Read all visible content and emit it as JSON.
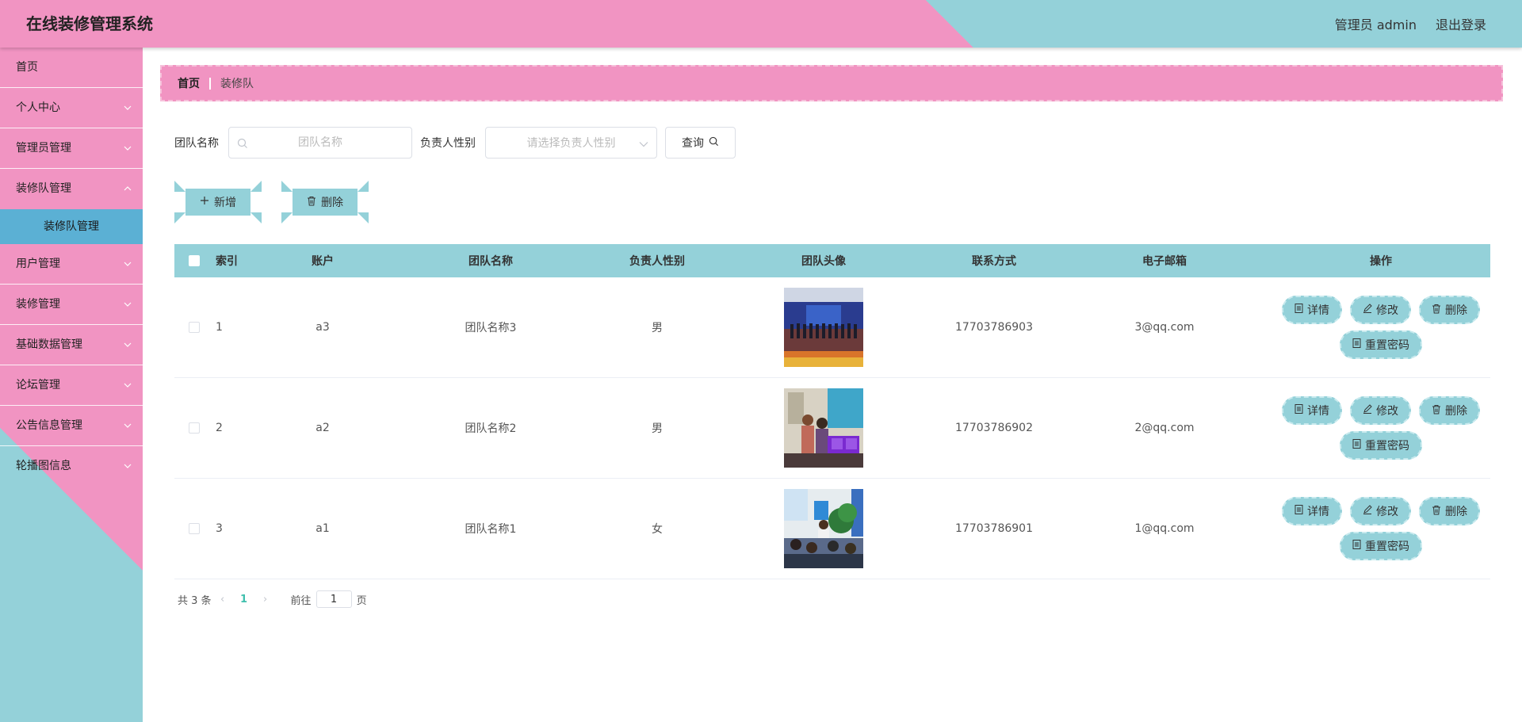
{
  "header": {
    "title": "在线装修管理系统",
    "user": "管理员 admin",
    "logout": "退出登录"
  },
  "sidebar": {
    "items": [
      {
        "label": "首页"
      },
      {
        "label": "个人中心"
      },
      {
        "label": "管理员管理"
      },
      {
        "label": "装修队管理",
        "submenu": "装修队管理"
      },
      {
        "label": "用户管理"
      },
      {
        "label": "装修管理"
      },
      {
        "label": "基础数据管理"
      },
      {
        "label": "论坛管理"
      },
      {
        "label": "公告信息管理"
      },
      {
        "label": "轮播图信息"
      }
    ]
  },
  "breadcrumb": {
    "home": "首页",
    "current": "装修队"
  },
  "search": {
    "team_label": "团队名称",
    "team_placeholder": "团队名称",
    "gender_label": "负责人性别",
    "gender_placeholder": "请选择负责人性别",
    "query": "查询"
  },
  "actions": {
    "add": "新增",
    "delete": "删除"
  },
  "table": {
    "headers": {
      "index": "索引",
      "account": "账户",
      "team": "团队名称",
      "gender": "负责人性别",
      "avatar": "团队头像",
      "phone": "联系方式",
      "email": "电子邮箱",
      "ops": "操作"
    },
    "rows": [
      {
        "index": "1",
        "account": "a3",
        "team": "团队名称3",
        "gender": "男",
        "phone": "17703786903",
        "email": "3@qq.com"
      },
      {
        "index": "2",
        "account": "a2",
        "team": "团队名称2",
        "gender": "男",
        "phone": "17703786902",
        "email": "2@qq.com"
      },
      {
        "index": "3",
        "account": "a1",
        "team": "团队名称1",
        "gender": "女",
        "phone": "17703786901",
        "email": "1@qq.com"
      }
    ],
    "ops": {
      "detail": "详情",
      "edit": "修改",
      "delete": "删除",
      "reset": "重置密码"
    }
  },
  "pagination": {
    "total": "共 3 条",
    "current": "1",
    "goto": "前往",
    "page_value": "1",
    "page_unit": "页"
  },
  "colors": {
    "pink": "#f194c2",
    "teal": "#94d1d9",
    "submenu": "#5bb0d4",
    "accent": "#3fbfad"
  }
}
